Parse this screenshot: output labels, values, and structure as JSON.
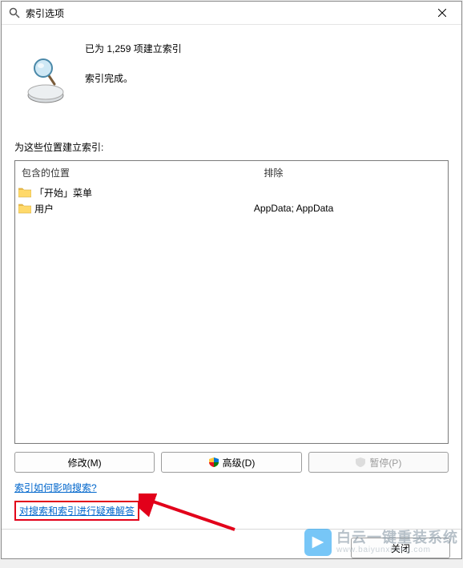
{
  "window": {
    "title": "索引选项"
  },
  "status": {
    "line1": "已为 1,259 项建立索引",
    "line2": "索引完成。"
  },
  "locations": {
    "label": "为这些位置建立索引:",
    "columns": {
      "included": "包含的位置",
      "excluded": "排除"
    },
    "rows": [
      {
        "name": "「开始」菜单",
        "exclude": ""
      },
      {
        "name": "用户",
        "exclude": "AppData; AppData"
      }
    ]
  },
  "buttons": {
    "modify": "修改(M)",
    "advanced": "高级(D)",
    "pause": "暂停(P)",
    "close": "关闭"
  },
  "links": {
    "help": "索引如何影响搜索?",
    "troubleshoot": "对搜索和索引进行疑难解答"
  },
  "watermark": {
    "cn": "白云一键重装系统",
    "url": "www.baiyunxitong.com"
  },
  "icons": {
    "title": "magnifier-icon",
    "magnifier": "magnifier-icon",
    "folder": "folder-icon",
    "shield": "shield-icon",
    "pause_shield": "shield-icon",
    "close": "close-icon"
  }
}
